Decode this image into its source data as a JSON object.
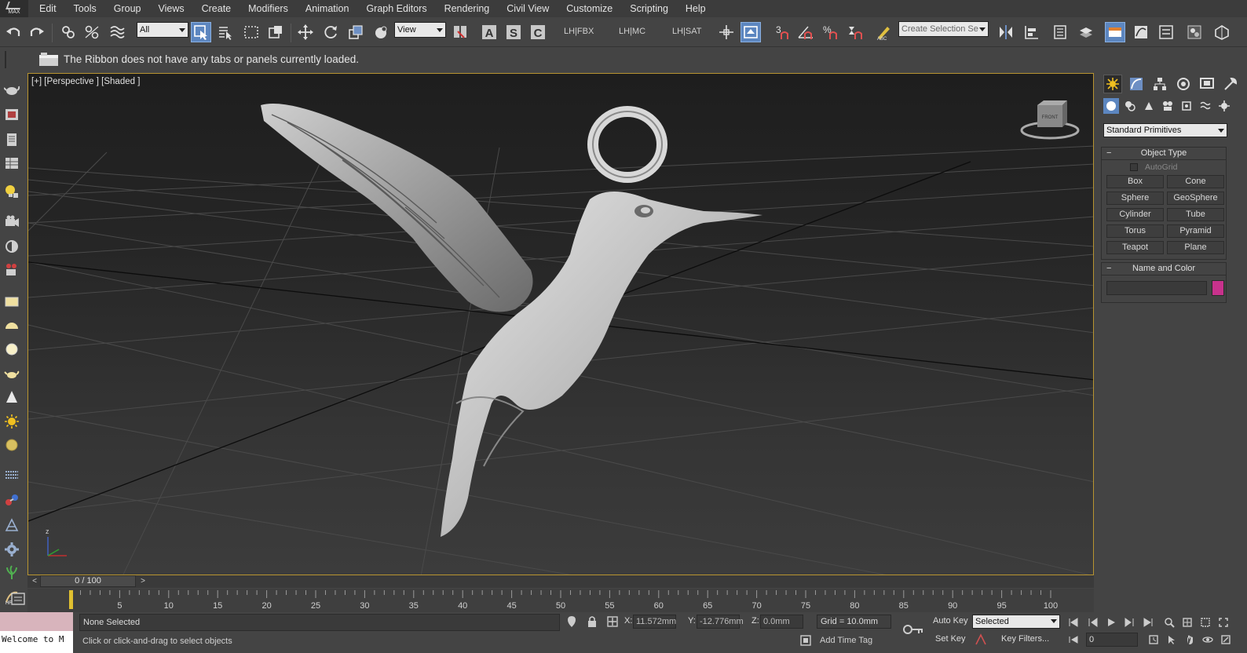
{
  "app": {
    "logo_text": "MAX"
  },
  "menu": [
    "Edit",
    "Tools",
    "Group",
    "Views",
    "Create",
    "Modifiers",
    "Animation",
    "Graph Editors",
    "Rendering",
    "Civil View",
    "Customize",
    "Scripting",
    "Help"
  ],
  "toolbar": {
    "selection_filter": "All",
    "ref_coord": "View",
    "link_fbx": "LH|FBX",
    "link_mc": "LH|MC",
    "link_sat": "LH|SAT",
    "snap_label": "3",
    "named_selection_placeholder": "Create Selection Se"
  },
  "ribbon": {
    "message": "The Ribbon does not have any tabs or panels currently loaded."
  },
  "viewport": {
    "label": "[+] [Perspective ] [Shaded ]",
    "viewcube_text": "FRONT",
    "axis_z": "z",
    "border_color": "#b89430"
  },
  "command_panel": {
    "category_dropdown": "Standard Primitives",
    "object_type": {
      "title": "Object Type",
      "autogrid": "AutoGrid",
      "buttons": [
        "Box",
        "Cone",
        "Sphere",
        "GeoSphere",
        "Cylinder",
        "Tube",
        "Torus",
        "Pyramid",
        "Teapot",
        "Plane"
      ]
    },
    "name_color": {
      "title": "Name and Color",
      "swatch_color": "#c8328c"
    }
  },
  "time_slider": {
    "position": "0 / 100",
    "ticks": [
      "5",
      "10",
      "15",
      "20",
      "25",
      "30",
      "35",
      "40",
      "45",
      "50",
      "55",
      "60",
      "65",
      "70",
      "75",
      "80",
      "85",
      "90",
      "95",
      "100"
    ]
  },
  "status": {
    "listener_output": "Welcome to M",
    "selection": "None Selected",
    "prompt": "Click or click-and-drag to select objects",
    "x_label": "X:",
    "x_value": "11.572mm",
    "y_label": "Y:",
    "y_value": "-12.776mm",
    "z_label": "Z:",
    "z_value": "0.0mm",
    "grid": "Grid = 10.0mm",
    "add_time_tag": "Add Time Tag",
    "auto_key": "Auto Key",
    "set_key": "Set Key",
    "key_mode": "Selected",
    "key_filters": "Key Filters...",
    "frame": "0"
  }
}
